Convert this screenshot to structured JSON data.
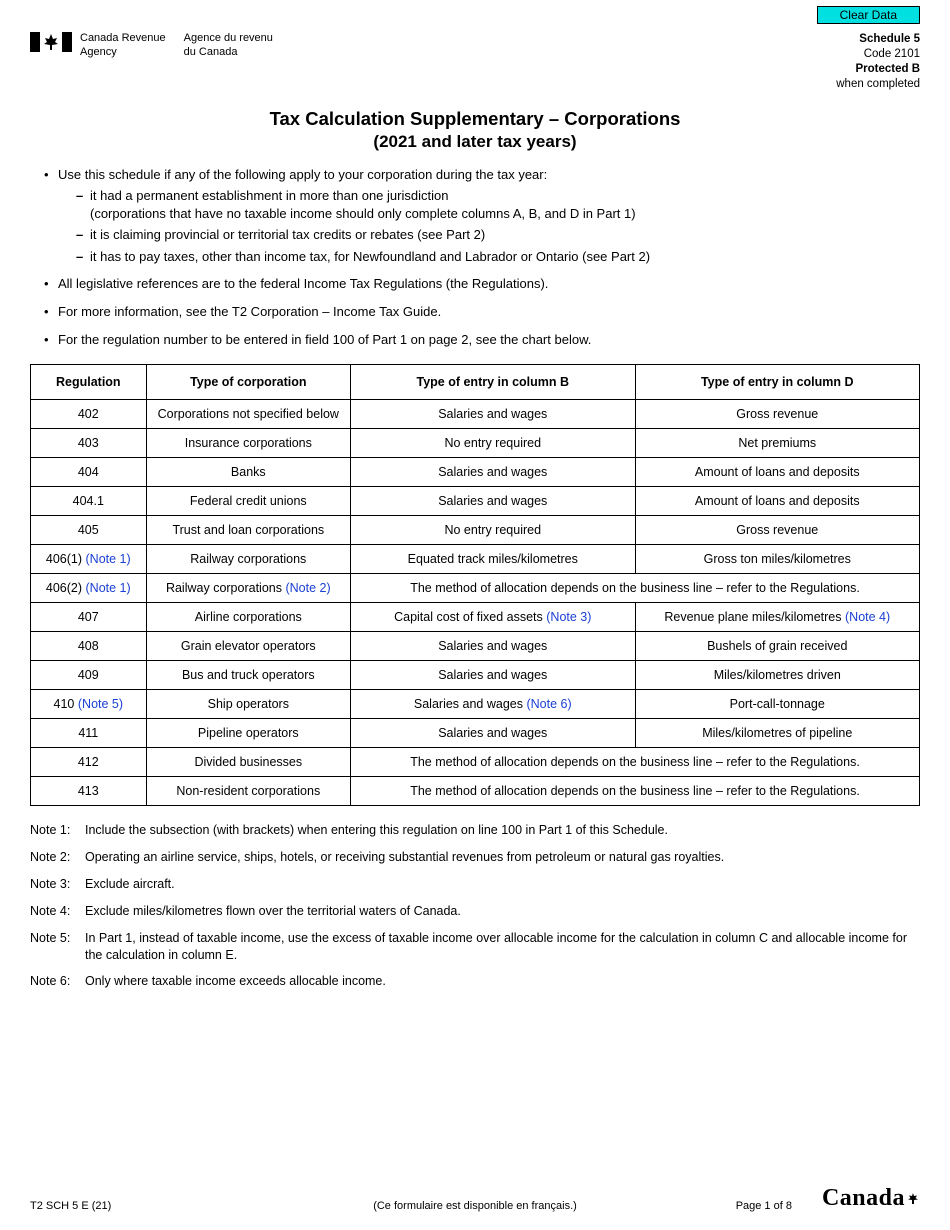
{
  "buttons": {
    "clear_data": "Clear Data"
  },
  "header": {
    "agency_en_l1": "Canada Revenue",
    "agency_en_l2": "Agency",
    "agency_fr_l1": "Agence du revenu",
    "agency_fr_l2": "du Canada",
    "schedule_label": "Schedule 5",
    "code_label": "Code 2101",
    "protected_label": "Protected B",
    "when_completed": "when completed"
  },
  "title": {
    "line1_a": "Tax Calculation Supplementary",
    "line1_sep": " – ",
    "line1_b": "Corporations",
    "line2": "(2021 and later tax years)"
  },
  "intro": {
    "b1": "Use this schedule if any of the following apply to your corporation during the tax year:",
    "d1": "it had a permanent establishment in more than one jurisdiction",
    "d1_sub": "(corporations that have no taxable income should only complete columns A, B, and D in Part 1)",
    "d2": "it is claiming provincial or territorial tax credits or rebates (see Part 2)",
    "d3": "it has to pay taxes, other than income tax, for Newfoundland and Labrador or Ontario (see Part 2)",
    "b2": "All legislative references are to the federal Income Tax Regulations (the Regulations).",
    "b3": "For more information, see the T2 Corporation – Income Tax Guide.",
    "b4": "For the regulation number to be entered in field 100 of Part 1 on page 2, see the chart below."
  },
  "table": {
    "headers": {
      "reg": "Regulation",
      "type_corp": "Type of corporation",
      "col_b": "Type of entry in column B",
      "col_d": "Type of entry in column D"
    },
    "rows": [
      {
        "reg": "402",
        "corp": "Corporations not specified below",
        "b": "Salaries and wages",
        "d": "Gross revenue"
      },
      {
        "reg": "403",
        "corp": "Insurance corporations",
        "b": "No entry required",
        "d": "Net premiums"
      },
      {
        "reg": "404",
        "corp": "Banks",
        "b": "Salaries and wages",
        "d": "Amount of loans and deposits"
      },
      {
        "reg": "404.1",
        "corp": "Federal credit unions",
        "b": "Salaries and wages",
        "d": "Amount of loans and deposits"
      },
      {
        "reg": "405",
        "corp": "Trust and loan corporations",
        "b": "No entry required",
        "d": "Gross revenue"
      },
      {
        "reg": "406(1)",
        "reg_note": "(Note 1)",
        "corp": "Railway corporations",
        "b": "Equated track miles/kilometres",
        "d": "Gross ton miles/kilometres"
      },
      {
        "reg": "406(2)",
        "reg_note": "(Note 1)",
        "corp": "Railway corporations",
        "corp_note": "(Note 2)",
        "merged_bd": "The method of allocation depends on the business line – refer to the Regulations."
      },
      {
        "reg": "407",
        "corp": "Airline corporations",
        "b": "Capital cost of fixed assets",
        "b_note": "(Note 3)",
        "d": "Revenue plane miles/kilometres",
        "d_note": "(Note 4)"
      },
      {
        "reg": "408",
        "corp": "Grain elevator operators",
        "b": "Salaries and wages",
        "d": "Bushels of grain received"
      },
      {
        "reg": "409",
        "corp": "Bus and truck operators",
        "b": "Salaries and wages",
        "d": "Miles/kilometres driven"
      },
      {
        "reg": "410",
        "reg_note": "(Note 5)",
        "corp": "Ship operators",
        "b": "Salaries and wages",
        "b_note": "(Note 6)",
        "d": "Port-call-tonnage"
      },
      {
        "reg": "411",
        "corp": "Pipeline operators",
        "b": "Salaries and wages",
        "d": "Miles/kilometres of pipeline"
      },
      {
        "reg": "412",
        "corp": "Divided businesses",
        "merged_bd": "The method of allocation depends on the business line – refer to the Regulations."
      },
      {
        "reg": "413",
        "corp": "Non-resident corporations",
        "merged_bd": "The method of allocation depends on the business line – refer to the Regulations."
      }
    ]
  },
  "notes": [
    {
      "label": "Note 1:",
      "text": "Include the subsection (with brackets) when entering this regulation on line 100 in Part 1 of this Schedule."
    },
    {
      "label": "Note 2:",
      "text": "Operating an airline service, ships, hotels, or receiving substantial revenues from petroleum or natural gas royalties."
    },
    {
      "label": "Note 3:",
      "text": "Exclude aircraft."
    },
    {
      "label": "Note 4:",
      "text": "Exclude miles/kilometres flown over the territorial waters of Canada."
    },
    {
      "label": "Note 5:",
      "text": "In Part 1, instead of taxable income, use the excess of taxable income over allocable income for the calculation in column C and allocable income for the calculation in column E."
    },
    {
      "label": "Note 6:",
      "text": "Only where taxable income exceeds allocable income."
    }
  ],
  "footer": {
    "form_id": "T2 SCH 5 E (21)",
    "french_note": "(Ce formulaire est disponible en français.)",
    "page": "Page 1 of 8",
    "wordmark": "Canada"
  }
}
